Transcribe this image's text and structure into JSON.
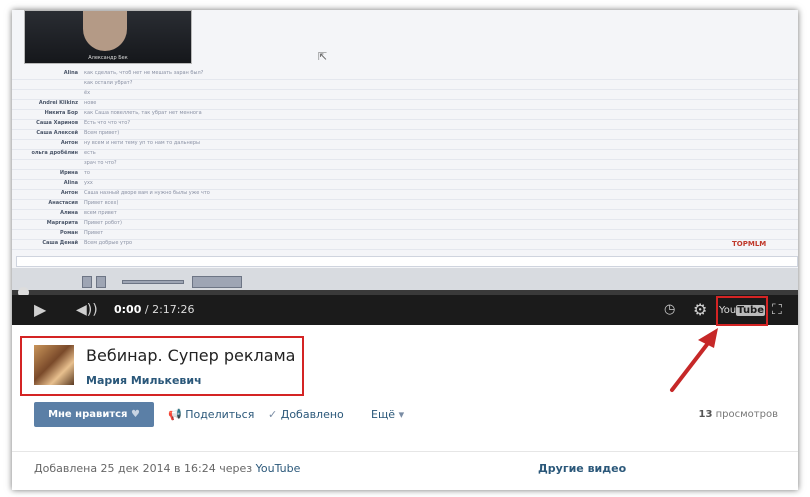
{
  "webcam": {
    "caption": "Александр Бек"
  },
  "chat": {
    "messages": [
      {
        "name": "Alina",
        "text": "как сделать, чтоб нет не мешать заран был?"
      },
      {
        "name": "",
        "text": "как остали убрат?"
      },
      {
        "name": "",
        "text": "ёх"
      },
      {
        "name": "Andrei Klikinz",
        "text": "нове"
      },
      {
        "name": "Никита Бор",
        "text": "как Саша повеллеть, так убрат нет меннога"
      },
      {
        "name": "Саша Харинов",
        "text": "Есть что что что?"
      },
      {
        "name": "Саша Алексей",
        "text": "Всем привет)"
      },
      {
        "name": "Антон",
        "text": "ну всем и нети тему уп то нам то дальнеры"
      },
      {
        "name": "ольга дробёлин",
        "text": "есть"
      },
      {
        "name": "",
        "text": "зрач то что?"
      },
      {
        "name": "Ирина",
        "text": "то"
      },
      {
        "name": "Alina",
        "text": "ухх"
      },
      {
        "name": "Антон",
        "text": "Саша назный дворе вам и нужно былы уже что"
      },
      {
        "name": "Анастасия",
        "text": "Привет всех)"
      },
      {
        "name": "Алина",
        "text": "всем привет"
      },
      {
        "name": "Маргарита",
        "text": "Привет робот)"
      },
      {
        "name": "Роман",
        "text": "Привет"
      },
      {
        "name": "Саша Денай",
        "text": "Всем добрые утро"
      }
    ]
  },
  "watermark": "TOPMLM",
  "player": {
    "current_time": "0:00",
    "separator": " / ",
    "duration": "2:17:26",
    "progress_fraction": 0.0,
    "youtube_label_a": "You",
    "youtube_label_b": "Tube",
    "icons": [
      "play-icon",
      "volume-icon",
      "watch-later-icon",
      "gear-icon",
      "fullscreen-icon"
    ]
  },
  "video": {
    "title": "Вебинар. Супер реклама",
    "author": "Мария Милькевич"
  },
  "actions": {
    "like": "Мне нравится",
    "share": "Поделиться",
    "added": "Добавлено",
    "more": "Ещё"
  },
  "views": {
    "count": "13",
    "label": "просмотров"
  },
  "footer": {
    "added_prefix": "Добавлена 25 дек 2014 в 16:24 через",
    "source": "YouTube",
    "other_videos": "Другие видео"
  },
  "colors": {
    "highlight": "#d42424",
    "link": "#2b587a",
    "button": "#5b7fa6"
  }
}
